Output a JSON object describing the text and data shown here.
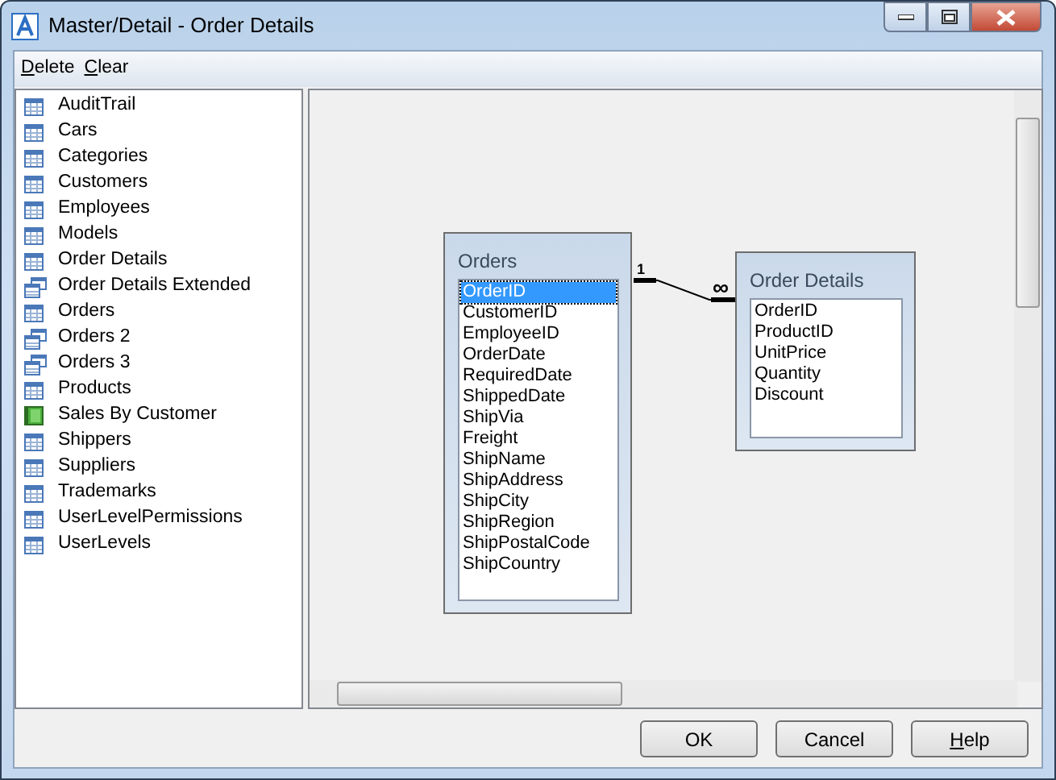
{
  "window": {
    "title": "Master/Detail - Order Details"
  },
  "menu": [
    {
      "label": "Delete",
      "mnemonic_underlined": true
    },
    {
      "label": "Clear",
      "mnemonic_underlined": true
    }
  ],
  "sidebar": {
    "items": [
      {
        "label": "AuditTrail",
        "kind": "table"
      },
      {
        "label": "Cars",
        "kind": "table"
      },
      {
        "label": "Categories",
        "kind": "table"
      },
      {
        "label": "Customers",
        "kind": "table"
      },
      {
        "label": "Employees",
        "kind": "table"
      },
      {
        "label": "Models",
        "kind": "table"
      },
      {
        "label": "Order Details",
        "kind": "table"
      },
      {
        "label": "Order Details Extended",
        "kind": "view"
      },
      {
        "label": "Orders",
        "kind": "table"
      },
      {
        "label": "Orders 2",
        "kind": "view"
      },
      {
        "label": "Orders 3",
        "kind": "view"
      },
      {
        "label": "Products",
        "kind": "table"
      },
      {
        "label": "Sales By Customer",
        "kind": "report"
      },
      {
        "label": "Shippers",
        "kind": "table"
      },
      {
        "label": "Suppliers",
        "kind": "table"
      },
      {
        "label": "Trademarks",
        "kind": "table"
      },
      {
        "label": "UserLevelPermissions",
        "kind": "table"
      },
      {
        "label": "UserLevels",
        "kind": "table"
      }
    ]
  },
  "diagram": {
    "tables": [
      {
        "title": "Orders",
        "fields": [
          {
            "label": "OrderID",
            "selected": true
          },
          {
            "label": "CustomerID",
            "selected": false
          },
          {
            "label": "EmployeeID",
            "selected": false
          },
          {
            "label": "OrderDate",
            "selected": false
          },
          {
            "label": "RequiredDate",
            "selected": false
          },
          {
            "label": "ShippedDate",
            "selected": false
          },
          {
            "label": "ShipVia",
            "selected": false
          },
          {
            "label": "Freight",
            "selected": false
          },
          {
            "label": "ShipName",
            "selected": false
          },
          {
            "label": "ShipAddress",
            "selected": false
          },
          {
            "label": "ShipCity",
            "selected": false
          },
          {
            "label": "ShipRegion",
            "selected": false
          },
          {
            "label": "ShipPostalCode",
            "selected": false
          },
          {
            "label": "ShipCountry",
            "selected": false
          }
        ]
      },
      {
        "title": "Order Details",
        "fields": [
          {
            "label": "OrderID",
            "selected": false
          },
          {
            "label": "ProductID",
            "selected": false
          },
          {
            "label": "UnitPrice",
            "selected": false
          },
          {
            "label": "Quantity",
            "selected": false
          },
          {
            "label": "Discount",
            "selected": false
          }
        ]
      }
    ],
    "relation": {
      "one_label": "1",
      "many_label": "∞"
    }
  },
  "buttons": [
    {
      "label": "OK",
      "mnemonic_underlined": false
    },
    {
      "label": "Cancel",
      "mnemonic_underlined": false
    },
    {
      "label": "Help",
      "mnemonic_underlined": true
    }
  ]
}
